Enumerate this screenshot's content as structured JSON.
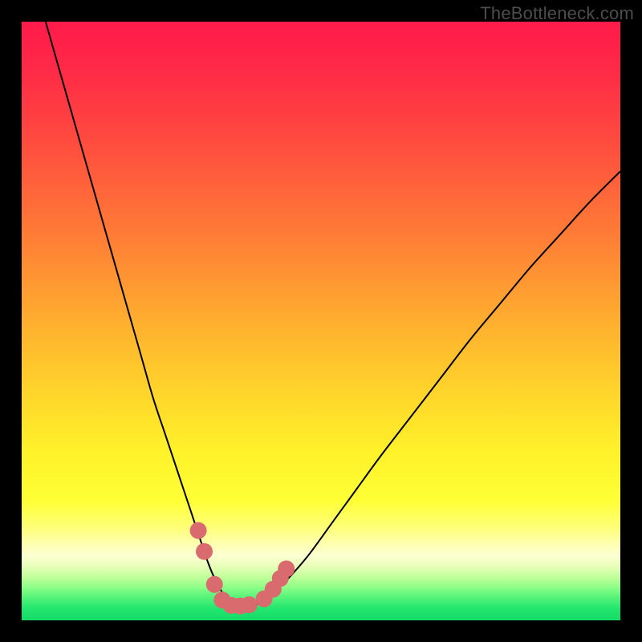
{
  "watermark": "TheBottleneck.com",
  "colors": {
    "frame": "#000000",
    "curve": "#000000",
    "marker_fill": "#d96a6e",
    "marker_stroke": "#d96a6e"
  },
  "gradient_stops": [
    {
      "offset": 0.0,
      "color": "#ff1a4a"
    },
    {
      "offset": 0.08,
      "color": "#ff2a47"
    },
    {
      "offset": 0.2,
      "color": "#ff4b3f"
    },
    {
      "offset": 0.35,
      "color": "#ff7a36"
    },
    {
      "offset": 0.5,
      "color": "#ffae2f"
    },
    {
      "offset": 0.62,
      "color": "#ffd52b"
    },
    {
      "offset": 0.72,
      "color": "#fff22a"
    },
    {
      "offset": 0.8,
      "color": "#ffff35"
    },
    {
      "offset": 0.845,
      "color": "#ffff7a"
    },
    {
      "offset": 0.872,
      "color": "#ffffb0"
    },
    {
      "offset": 0.892,
      "color": "#fdffd2"
    },
    {
      "offset": 0.91,
      "color": "#e8ffb8"
    },
    {
      "offset": 0.928,
      "color": "#c0ff9a"
    },
    {
      "offset": 0.945,
      "color": "#8cff87"
    },
    {
      "offset": 0.962,
      "color": "#55f37a"
    },
    {
      "offset": 0.98,
      "color": "#23e66e"
    },
    {
      "offset": 1.0,
      "color": "#13dc67"
    }
  ],
  "chart_data": {
    "type": "line",
    "title": "",
    "xlabel": "",
    "ylabel": "",
    "xlim": [
      0,
      100
    ],
    "ylim": [
      0,
      100
    ],
    "series": [
      {
        "name": "bottleneck-curve",
        "x": [
          4,
          6,
          8,
          10,
          12,
          14,
          16,
          18,
          20,
          22,
          24,
          26,
          28,
          30,
          31,
          32,
          33,
          34,
          35,
          36,
          37,
          38,
          40,
          42,
          45,
          48,
          52,
          56,
          60,
          65,
          70,
          75,
          80,
          85,
          90,
          95,
          100
        ],
        "y": [
          100,
          93,
          86,
          79,
          72,
          65,
          58,
          51,
          44,
          37,
          31,
          25,
          19,
          13,
          10,
          7.5,
          5.5,
          4,
          3,
          2.5,
          2.2,
          2.3,
          3,
          4.5,
          7.5,
          11,
          16.5,
          22,
          27.5,
          34,
          40.5,
          47,
          53,
          59,
          64.5,
          70,
          75
        ]
      }
    ],
    "markers": [
      {
        "x": 29.5,
        "y": 15.0
      },
      {
        "x": 30.5,
        "y": 11.5
      },
      {
        "x": 32.2,
        "y": 6.0
      },
      {
        "x": 33.5,
        "y": 3.4
      },
      {
        "x": 35.0,
        "y": 2.5
      },
      {
        "x": 36.5,
        "y": 2.4
      },
      {
        "x": 38.0,
        "y": 2.6
      },
      {
        "x": 40.5,
        "y": 3.6
      },
      {
        "x": 42.0,
        "y": 5.2
      },
      {
        "x": 43.2,
        "y": 7.0
      },
      {
        "x": 44.2,
        "y": 8.6
      }
    ]
  }
}
